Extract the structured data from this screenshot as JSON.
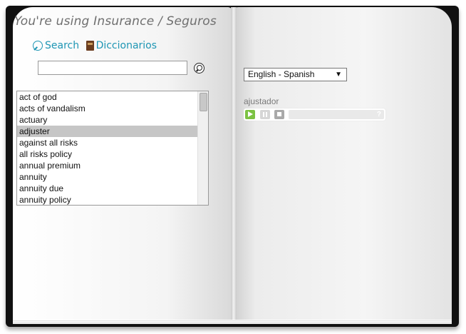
{
  "header": {
    "title": "You're using Insurance / Seguros"
  },
  "nav": {
    "search_label": "Search",
    "dictionaries_label": "Diccionarios",
    "search_icon": "search-icon",
    "dictionaries_icon": "book-icon"
  },
  "search": {
    "value": "",
    "placeholder": ""
  },
  "word_list": {
    "selected_index": 3,
    "items": [
      "act of god",
      "acts of vandalism",
      "actuary",
      "adjuster",
      "against all risks",
      "all risks policy",
      "annual premium",
      "annuity",
      "annuity due",
      "annuity policy"
    ]
  },
  "language": {
    "selected": "English - Spanish",
    "arrow": "▼"
  },
  "result": {
    "translation": "ajustador"
  },
  "player": {
    "help": "?",
    "progress": 0
  },
  "colors": {
    "link": "#1e96b4",
    "play": "#7cc243",
    "selected_row": "#c6c6c6"
  }
}
